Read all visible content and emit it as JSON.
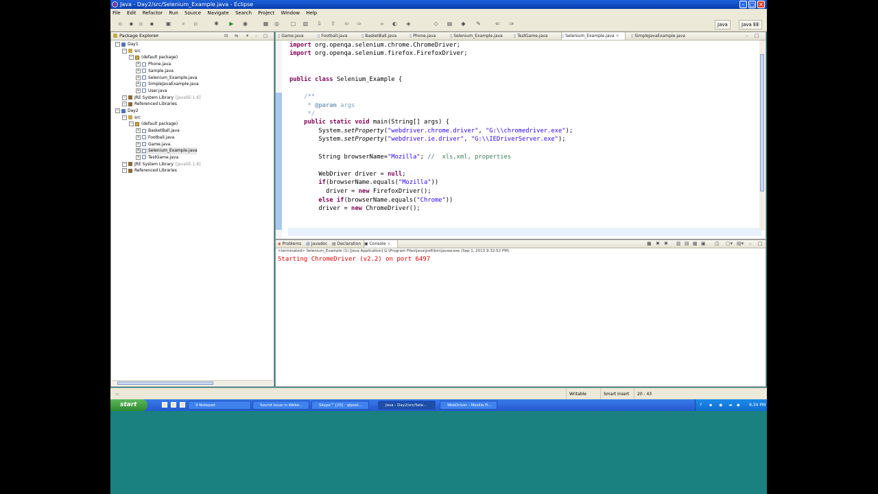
{
  "window": {
    "title": "Java - Day2/src/Selenium_Example.java - Eclipse"
  },
  "menu": [
    "File",
    "Edit",
    "Refactor",
    "Run",
    "Source",
    "Navigate",
    "Search",
    "Project",
    "Window",
    "Help"
  ],
  "perspectives": [
    "Java",
    "Java EE"
  ],
  "package_explorer": {
    "title": "Package Explorer",
    "tree": [
      {
        "label": "Day1",
        "depth": 0,
        "icon": "project-icon"
      },
      {
        "label": "src",
        "depth": 1,
        "icon": "source-folder-icon"
      },
      {
        "label": "(default package)",
        "depth": 2,
        "icon": "package-icon"
      },
      {
        "label": "Phone.java",
        "depth": 3,
        "icon": "java-file-icon"
      },
      {
        "label": "Sample.java",
        "depth": 3,
        "icon": "java-file-icon"
      },
      {
        "label": "Selenium_Example.java",
        "depth": 3,
        "icon": "java-file-icon"
      },
      {
        "label": "SimpleJavaExample.java",
        "depth": 3,
        "icon": "java-file-icon"
      },
      {
        "label": "User.java",
        "depth": 3,
        "icon": "java-file-icon"
      },
      {
        "label": "JRE System Library",
        "suffix": "[JavaSE-1.6]",
        "depth": 1,
        "icon": "library-icon"
      },
      {
        "label": "Referenced Libraries",
        "depth": 1,
        "icon": "library-icon"
      },
      {
        "label": "Day2",
        "depth": 0,
        "icon": "project-icon"
      },
      {
        "label": "src",
        "depth": 1,
        "icon": "source-folder-icon"
      },
      {
        "label": "(default package)",
        "depth": 2,
        "icon": "package-icon"
      },
      {
        "label": "BasketBall.java",
        "depth": 3,
        "icon": "java-file-icon"
      },
      {
        "label": "Football.java",
        "depth": 3,
        "icon": "java-file-icon"
      },
      {
        "label": "Game.java",
        "depth": 3,
        "icon": "java-file-icon"
      },
      {
        "label": "Selenium_Example.java",
        "depth": 3,
        "icon": "java-file-icon"
      },
      {
        "label": "TestGame.java",
        "depth": 3,
        "icon": "java-file-icon"
      },
      {
        "label": "JRE System Library",
        "suffix": "[JavaSE-1.6]",
        "depth": 1,
        "icon": "library-icon"
      },
      {
        "label": "Referenced Libraries",
        "depth": 1,
        "icon": "library-icon"
      }
    ]
  },
  "editor": {
    "tabs": [
      "Game.java",
      "Football.java",
      "BasketBall.java",
      "Phone.java",
      "Selenium_Example.java",
      "TestGame.java",
      "Selenium_Example.java",
      "SimpleJavaExample.java"
    ],
    "active_tab": 6,
    "code": {
      "l1a": "import",
      "l1b": " org.openqa.selenium.chrome.ChromeDriver;",
      "l2a": "import",
      "l2b": " org.openqa.selenium.firefox.FirefoxDriver;",
      "l3a": "public class",
      "l3b": " Selenium_Example {",
      "l4": "    /**",
      "l5a": "     * ",
      "l5b": "@param",
      "l5c": " args",
      "l6": "     */",
      "l7a": "    public static void",
      "l7b": " main(String[] args) {",
      "l8a": "        System.",
      "l8b": "setProperty",
      "l8c": "(",
      "l8d": "\"webdriver.chrome.driver\"",
      "l8e": ", ",
      "l8f": "\"G:\\\\chromedriver.exe\"",
      "l8g": ");",
      "l9a": "        System.",
      "l9b": "setProperty",
      "l9c": "(",
      "l9d": "\"webdriver.ie.driver\"",
      "l9e": ", ",
      "l9f": "\"G:\\\\IEDriverServer.exe\"",
      "l9g": ");",
      "l10a": "        String browserName=",
      "l10b": "\"Mozilla\"",
      "l10c": "; ",
      "l10d": "//  xls,xml, properties",
      "l11a": "        WebDriver driver = ",
      "l11b": "null",
      "l11c": ";",
      "l12a": "        if",
      "l12b": "(browserName.equals(",
      "l12c": "\"Mozilla\"",
      "l12d": "))",
      "l13a": "          driver = ",
      "l13b": "new",
      "l13c": " FirefoxDriver();",
      "l14a": "        else if",
      "l14b": "(browserName.equals(",
      "l14c": "\"Chrome\"",
      "l14d": "))",
      "l15a": "        driver = ",
      "l15b": "new",
      "l15c": " ChromeDriver();"
    }
  },
  "console": {
    "tabs": [
      "Problems",
      "Javadoc",
      "Declaration",
      "Console"
    ],
    "active_tab": 3,
    "info": "<terminated> Selenium_Example (1) [Java Application] G:\\Program Files\\Java\\jre6\\bin\\javaw.exe (Sep 1, 2013 9:32:52 PM)",
    "output": "Starting ChromeDriver (v2.2) on port 6497"
  },
  "status": {
    "writable": "Writable",
    "insert_mode": "Smart Insert",
    "position": "20 : 43"
  },
  "taskbar": {
    "start": "start",
    "tasks": [
      "9 Notepad",
      "Sound Issue in Webe...",
      "Skype™ [20] - qtpsel...",
      "Java - Day2/src/Sele...",
      "WebDriver - Mozilla Fi..."
    ],
    "clock": "9:34 PM"
  }
}
